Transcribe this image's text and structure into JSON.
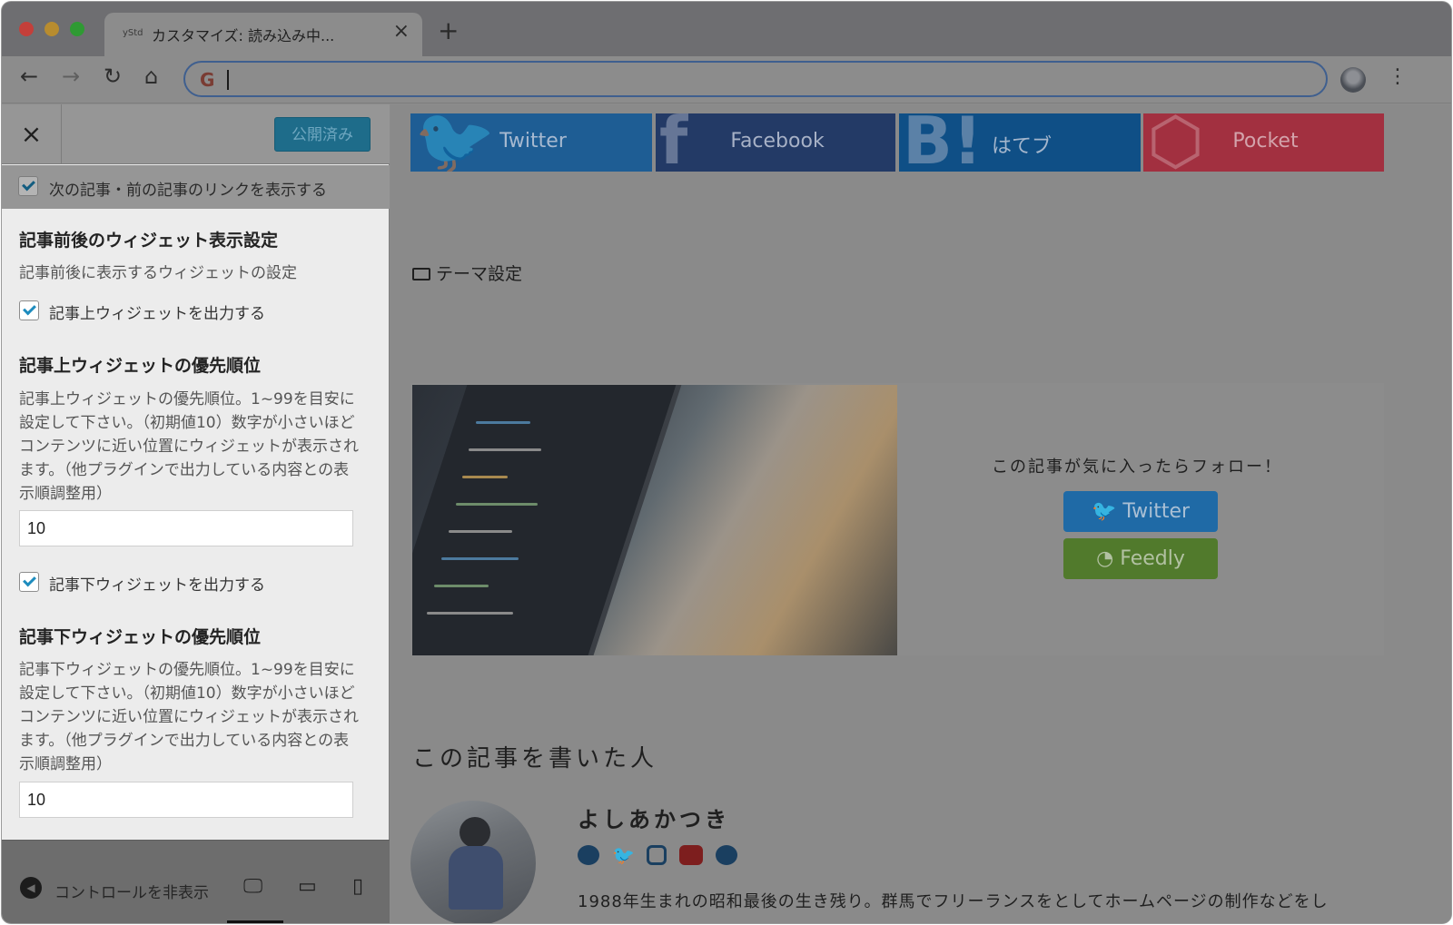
{
  "browser": {
    "tab_favicon": "yStd",
    "tab_title": "カスタマイズ: 読み込み中...",
    "tab_close": "×",
    "new_tab": "+",
    "nav_back": "←",
    "nav_forward": "→",
    "nav_reload": "↻",
    "nav_home": "⌂",
    "omnibox_icon": "G",
    "omnibox_value": "",
    "menu": "⋮"
  },
  "customizer": {
    "close": "×",
    "publish_label": "公開済み",
    "prev_next_link_label": "次の記事・前の記事のリンクを表示する",
    "section_title": "記事前後のウィジェット表示設定",
    "section_desc": "記事前後に表示するウィジェットの設定",
    "above_widget_label": "記事上ウィジェットを出力する",
    "above_priority_title": "記事上ウィジェットの優先順位",
    "above_priority_desc": "記事上ウィジェットの優先順位。1~99を目安に設定して下さい。（初期値10）数字が小さいほどコンテンツに近い位置にウィジェットが表示されます。（他プラグインで出力している内容との表示順調整用）",
    "above_priority_value": "10",
    "below_widget_label": "記事下ウィジェットを出力する",
    "below_priority_title": "記事下ウィジェットの優先順位",
    "below_priority_desc": "記事下ウィジェットの優先順位。1~99を目安に設定して下さい。（初期値10）数字が小さいほどコンテンツに近い位置にウィジェットが表示されます。（他プラグインで出力している内容との表示順調整用）",
    "below_priority_value": "10",
    "collapse_label": "コントロールを非表示",
    "device_desktop": "🖵",
    "device_tablet": "▭",
    "device_mobile": "▯"
  },
  "preview": {
    "share": {
      "twitter": "Twitter",
      "facebook": "Facebook",
      "hatena": "はてブ",
      "pocket": "Pocket"
    },
    "category": "テーマ設定",
    "follow_text": "この記事が気に入ったらフォロー！",
    "follow_twitter": "Twitter",
    "follow_feedly": "Feedly",
    "author_heading": "この記事を書いた人",
    "author_name": "よしあかつき",
    "author_bio": "1988年生まれの昭和最後の生き残り。群馬でフリーランスをとしてホームページの制作などをし"
  },
  "colors": {
    "twitter": "#1e5d94",
    "facebook": "#233a66",
    "hatena": "#0f4f86",
    "pocket": "#a23040",
    "feedly": "#517a2c",
    "accent": "#1e8cbe"
  }
}
